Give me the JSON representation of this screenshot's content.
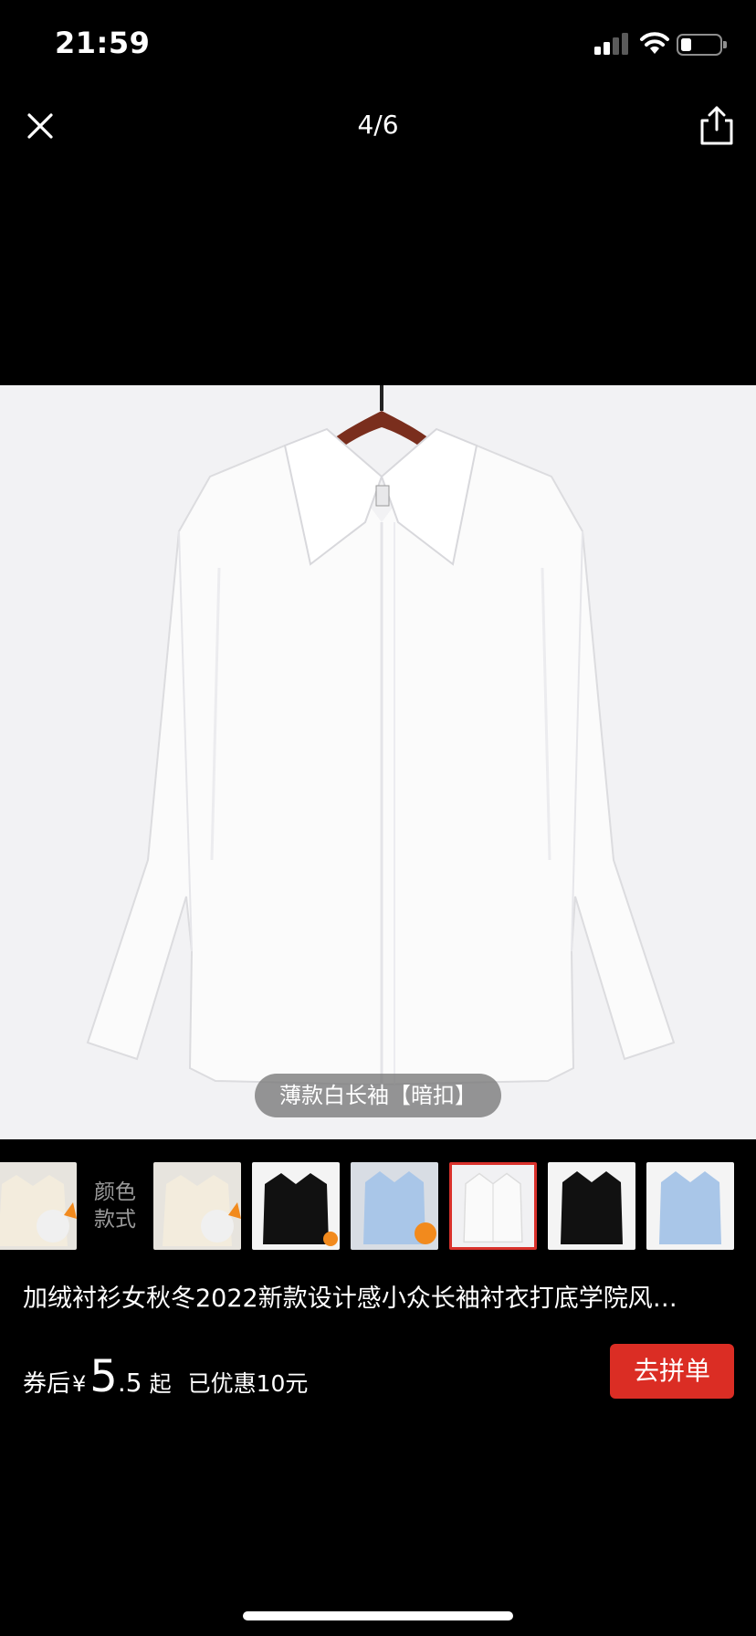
{
  "status_bar": {
    "time": "21:59"
  },
  "nav": {
    "counter": "4/6",
    "close_icon": "close-icon",
    "share_icon": "share-icon"
  },
  "photo": {
    "variant_label": "薄款白长袖【暗扣】",
    "background_color": "#f2f2f4"
  },
  "thumbnails": {
    "section_label_line1": "颜色",
    "section_label_line2": "款式",
    "items": [
      {
        "shirt_color": "#f3ecdd",
        "selected": false
      },
      {
        "shirt_color": "#f3ecdd",
        "selected": false
      },
      {
        "shirt_color": "#111111",
        "selected": false
      },
      {
        "shirt_color": "#a9c6e8",
        "selected": false
      },
      {
        "shirt_color": "#fafafa",
        "selected": true
      },
      {
        "shirt_color": "#111111",
        "selected": false
      },
      {
        "shirt_color": "#a9c6e8",
        "selected": false
      }
    ]
  },
  "product": {
    "title": "加绒衬衫女秋冬2022新款设计感小众长袖衬衣打底学院风…",
    "price_prefix": "券后",
    "currency_symbol": "¥",
    "price_integer": "5",
    "price_decimal": ".5",
    "price_suffix": "起",
    "discount_text": "已优惠10元",
    "buy_button": "去拼单"
  },
  "colors": {
    "accent": "#db2d24",
    "selected_border": "#d9312b"
  }
}
